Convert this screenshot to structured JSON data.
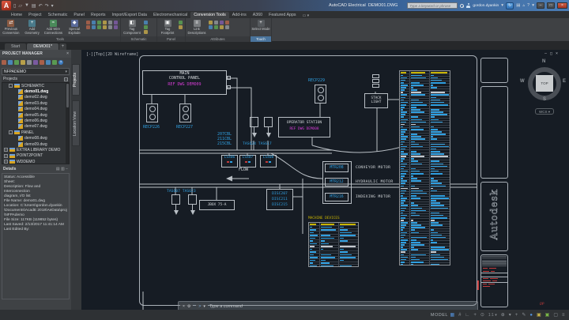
{
  "colors": {
    "accent_cyan": "#2f9fe0",
    "magenta": "#d63cd6",
    "table_header_yellow": "#c9b400",
    "wire": "#b9bfc5",
    "titleblock_red": "#c23b3b",
    "canvas_bg": "#161c24"
  },
  "title_bar": {
    "app_name": "AutoCAD Electrical",
    "doc_name": "DEMO01.DWG",
    "search_placeholder": "Type a keyword or phrase",
    "user_name": "gordon.dyankin",
    "sync_badge": "↻",
    "window_controls": [
      "–",
      "□",
      "×"
    ]
  },
  "ribbon": {
    "tabs": [
      "Home",
      "Project",
      "Schematic",
      "Panel",
      "Reports",
      "Import/Export Data",
      "Electromechanical",
      "Conversion Tools",
      "Add-ins",
      "A360",
      "Featured Apps"
    ],
    "active_tab": "Conversion Tools",
    "groups": [
      {
        "label": "Tools",
        "buttons": [
          {
            "label": "Previous Conversion",
            "icon": "previous-conversion-icon"
          },
          {
            "label": "Add Geometry",
            "icon": "add-geometry-icon"
          },
          {
            "label": "Add Wire Connections",
            "icon": "add-wire-connections-icon"
          },
          {
            "label": "Special Explode",
            "icon": "special-explode-icon"
          }
        ]
      },
      {
        "label": "Schematic",
        "buttons": [
          {
            "label": "Tag Component",
            "icon": "tag-component-icon"
          }
        ]
      },
      {
        "label": "Panel",
        "buttons": [
          {
            "label": "Tag Footprint",
            "icon": "tag-footprint-icon"
          }
        ]
      },
      {
        "label": "Attributes",
        "buttons": [
          {
            "label": "Link Descriptions",
            "icon": "link-descriptions-icon"
          }
        ]
      },
      {
        "label": "Touch",
        "buttons": [
          {
            "label": "Select Mode",
            "icon": "select-mode-icon"
          }
        ]
      }
    ]
  },
  "file_tabs": {
    "start": "Start",
    "doc": "DEMO01*",
    "new_label": "+"
  },
  "project_manager": {
    "header": "PROJECT MANAGER",
    "toolbar_icons": [
      "project-new-icon",
      "project-open-icon",
      "project-refresh-icon",
      "plot-publish-icon",
      "drawing-list-icon",
      "project-settings-icon",
      "title-block-icon",
      "exchange-icon",
      "dropdown-icon",
      "help-icon"
    ],
    "dropdown": "NFPADEMO",
    "section_label": "Projects",
    "side_tabs": [
      "Projects",
      "Location View"
    ],
    "tree": [
      {
        "label": "SCHEMATIC",
        "kind": "folder",
        "exp": "-"
      },
      {
        "label": "demo01.dwg",
        "kind": "dwg",
        "selected": true
      },
      {
        "label": "demo02.dwg",
        "kind": "dwg"
      },
      {
        "label": "demo03.dwg",
        "kind": "dwg"
      },
      {
        "label": "demo04.dwg",
        "kind": "dwg"
      },
      {
        "label": "demo05.dwg",
        "kind": "dwg"
      },
      {
        "label": "demo06.dwg",
        "kind": "dwg"
      },
      {
        "label": "demo07.dwg",
        "kind": "dwg"
      },
      {
        "label": "PANEL",
        "kind": "folder",
        "exp": "-"
      },
      {
        "label": "demo08.dwg",
        "kind": "dwg"
      },
      {
        "label": "demo09.dwg",
        "kind": "dwg"
      },
      {
        "label": "EXTRA LIBRARY DEMO",
        "kind": "proj",
        "exp": "+"
      },
      {
        "label": "POINT2POINT",
        "kind": "proj",
        "exp": "+"
      },
      {
        "label": "WDDEMO",
        "kind": "proj",
        "exp": "+"
      }
    ],
    "details_title": "Details",
    "details_lines": [
      "Status: Accessible",
      "Sheet:",
      "Description: Flow and Interconnection",
      "diagram, I/O list",
      "",
      "File Name: demo01.dwg",
      "",
      "Location: C:\\Users\\gordon.dyankin",
      "\\Documents\\AcadE 2018\\AeData\\proj",
      "\\NFPAdemo",
      "",
      "File Size: 117KB (119852 bytes)",
      "Last Saved: 2/13/2017 11:41:14 AM",
      "Last Edited By:"
    ]
  },
  "canvas": {
    "viewport_label": "[-][Top][2D Wireframe]",
    "win_controls": [
      "—",
      "□",
      "×"
    ],
    "schematic": {
      "mcp_title_1": "MAIN",
      "mcp_title_2": "CONTROL PANEL",
      "mcp_ref": "REF DWG DEMO09",
      "recp226": "RECP226",
      "recp227": "RECP227",
      "recp229": "RECP229",
      "stack_light_1": "STACK",
      "stack_light_2": "LIGHT",
      "op_title": "OPERATOR STATION",
      "op_ref": "REF DWG DEMO08",
      "tas_top": "TAS624 TAS617",
      "cable_1": "207CBL",
      "cable_2": "211CBL",
      "cable_3": "215CBL",
      "ls_1": "LS406",
      "ls_2": "LS407",
      "ls_3": "LS408",
      "flow": "FLOW",
      "disc_1": "DISC207",
      "disc_2": "DISC211",
      "disc_3": "DISC215",
      "tas_bottom": "TAS607 TAS623",
      "jbox": "JBOX 75-A",
      "motors": [
        {
          "tag": "MTR208",
          "desc": "CONVEYOR MOTOR"
        },
        {
          "tag": "MTR212",
          "desc": "HYDRAULIC MOTOR"
        },
        {
          "tag": "MTR216",
          "desc": "INDEXING MOTOR"
        }
      ],
      "machine_table_title": "MACHINE DEVICES",
      "autodesk_logo": "Autodesk",
      "plot_stamp": "OP"
    },
    "wire_table": {
      "rows": 78
    },
    "machine_table": {
      "rows": 15
    },
    "viewcube": {
      "north": "N",
      "south": "S",
      "east": "E",
      "west": "W",
      "face": "TOP",
      "wcs": "WCS"
    }
  },
  "command_line": {
    "placeholder": "Type a command"
  },
  "status_bar": {
    "model_label": "MODEL",
    "scale_label": "1:1 ▾"
  }
}
